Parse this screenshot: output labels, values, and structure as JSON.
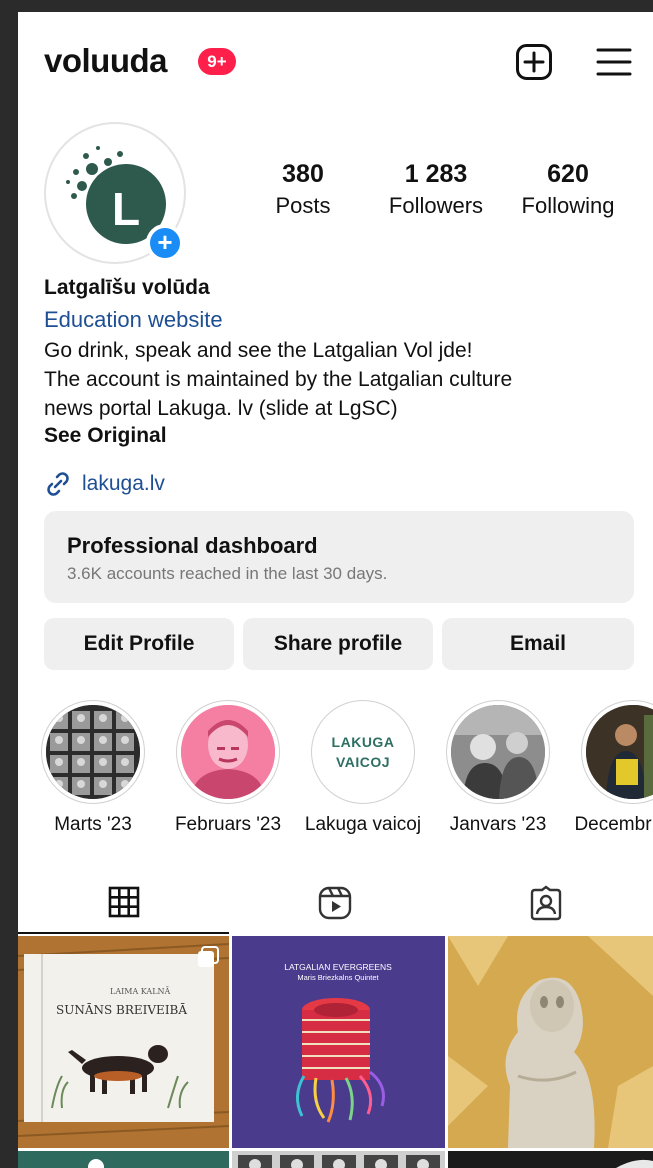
{
  "header": {
    "username": "voluuda",
    "notification_badge": "9+"
  },
  "profile": {
    "stats": [
      {
        "value": "380",
        "label": "Posts"
      },
      {
        "value": "1 283",
        "label": "Followers"
      },
      {
        "value": "620",
        "label": "Following"
      }
    ],
    "display_name": "Latgalīšu volūda",
    "category": "Education website",
    "bio_lines": [
      "Go drink, speak and see the Latgalian Vol jde!",
      "The account is maintained by the Latgalian culture",
      "news portal Lakuga. lv (slide at LgSC)"
    ],
    "see_original": "See Original",
    "link": "lakuga.lv"
  },
  "dashboard": {
    "title": "Professional dashboard",
    "subtitle": "3.6K accounts reached in the last 30 days."
  },
  "actions": {
    "edit": "Edit Profile",
    "share": "Share profile",
    "email": "Email"
  },
  "highlights": [
    {
      "label": "Marts '23"
    },
    {
      "label": "Februars '23"
    },
    {
      "label": "Lakuga vaicoj",
      "cover_text": [
        "LAKUGA",
        "VAICOJ"
      ]
    },
    {
      "label": "Janvars '23"
    },
    {
      "label": "Decembr"
    }
  ],
  "posts": [
    {
      "title": "LAIMA KALNĀ",
      "subtitle": "SUNĀNS BREIVEIBĀ"
    },
    {
      "title": "LATGALIAN EVERGREENS",
      "subtitle": "Maris Briezkalns Quintet"
    },
    {},
    {},
    {},
    {}
  ],
  "colors": {
    "accent_link": "#1e4f93",
    "badge_red": "#ff1f4b",
    "add_blue": "#1a8cf5",
    "brand_green": "#2e5a4e"
  }
}
